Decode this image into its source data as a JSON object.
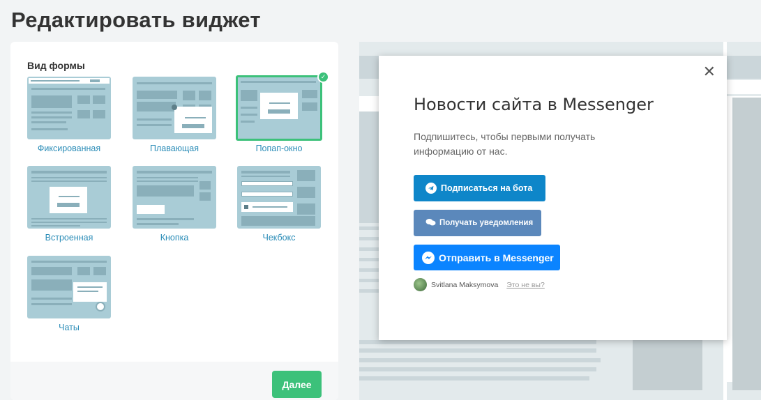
{
  "page": {
    "title": "Редактировать виджет"
  },
  "form": {
    "section_label": "Вид формы",
    "options": [
      {
        "label": "Фиксированная",
        "selected": false
      },
      {
        "label": "Плавающая",
        "selected": false
      },
      {
        "label": "Попап-окно",
        "selected": true
      },
      {
        "label": "Встроенная",
        "selected": false
      },
      {
        "label": "Кнопка",
        "selected": false
      },
      {
        "label": "Чекбокс",
        "selected": false
      },
      {
        "label": "Чаты",
        "selected": false
      }
    ],
    "next_label": "Далее"
  },
  "preview": {
    "modal": {
      "title": "Новости сайта в Messenger",
      "description": "Подпишитесь, чтобы первыми получать информацию от нас.",
      "btn_bot": "Подписаться на бота",
      "btn_notify": "Получать уведомления",
      "btn_messenger": "Отправить в Messenger",
      "user_name": "Svitlana Maksymova",
      "not_you": "Это не вы?",
      "close": "✕"
    }
  },
  "colors": {
    "accent": "#3cc17a",
    "link": "#2a8cb7",
    "telegram": "#0e86c9",
    "vk": "#5b88bb",
    "messenger": "#0b84ff",
    "thumb": "#a9ccd6"
  }
}
